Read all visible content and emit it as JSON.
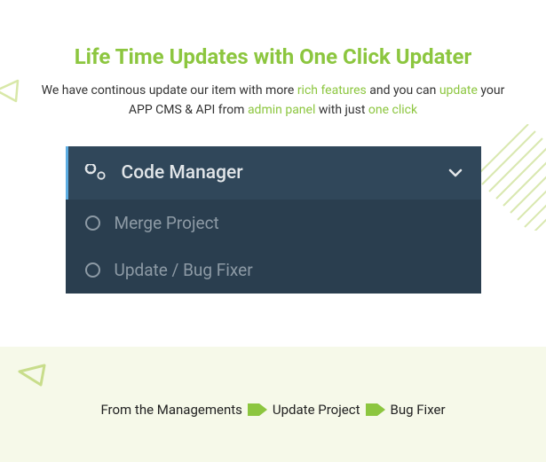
{
  "colors": {
    "accent": "#8cc63f",
    "panel_bg": "#2a3e4f",
    "panel_header_bg": "#30475a",
    "panel_border": "#5dade2",
    "panel_text": "#e2e6e9",
    "panel_subtext": "#8d9aa5",
    "bottom_bg": "#f6f9e9"
  },
  "title": "Life Time Updates with One Click Updater",
  "subtitle": {
    "t1": "We have continous update our item with more ",
    "h1": "rich features",
    "t2": " and you can ",
    "h2": "update",
    "t3": " your APP CMS & API from ",
    "h3": "admin panel",
    "t4": " with just ",
    "h4": "one click"
  },
  "panel": {
    "header": "Code Manager",
    "items": [
      {
        "label": "Merge Project"
      },
      {
        "label": "Update / Bug Fixer"
      }
    ]
  },
  "breadcrumb": {
    "a": "From the Managements",
    "b": "Update Project",
    "c": "Bug Fixer"
  }
}
